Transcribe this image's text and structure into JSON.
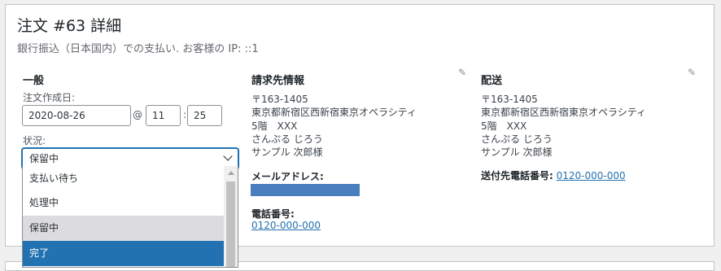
{
  "header": {
    "title": "注文 #63 詳細",
    "subtitle": "銀行振込（日本国内）での支払い. お客様の IP: ::1"
  },
  "general": {
    "heading": "一般",
    "date_label": "注文作成日:",
    "date_value": "2020-08-26",
    "at_symbol": "@",
    "hour_value": "11",
    "time_colon": ":",
    "minute_value": "25",
    "status_label": "状況:",
    "status_selected": "保留中",
    "status_options": [
      "支払い待ち",
      "処理中",
      "保留中",
      "完了"
    ]
  },
  "billing": {
    "heading": "請求先情報",
    "address_lines": [
      "〒163-1405",
      "東京都新宿区西新宿東京オペラシティ",
      "5階　XXX",
      "さんぷる じろう",
      "サンプル 次郎様"
    ],
    "email_label": "メールアドレス:",
    "phone_label": "電話番号:",
    "phone_value": "0120-000-000"
  },
  "shipping": {
    "heading": "配送",
    "address_lines": [
      "〒163-1405",
      "東京都新宿区西新宿東京オペラシティ",
      "5階　XXX",
      "さんぷる じろう",
      "サンプル 次郎様"
    ],
    "phone_label": "送付先電話番号:",
    "phone_value": "0120-000-000"
  },
  "icons": {
    "edit": "pencil-icon",
    "dropdown": "chevron-down-icon",
    "scroll": "scroll-up-arrow-icon"
  },
  "colors": {
    "accent": "#2271b1",
    "hover": "#dcdcde",
    "redaction": "#4a7fbf"
  }
}
